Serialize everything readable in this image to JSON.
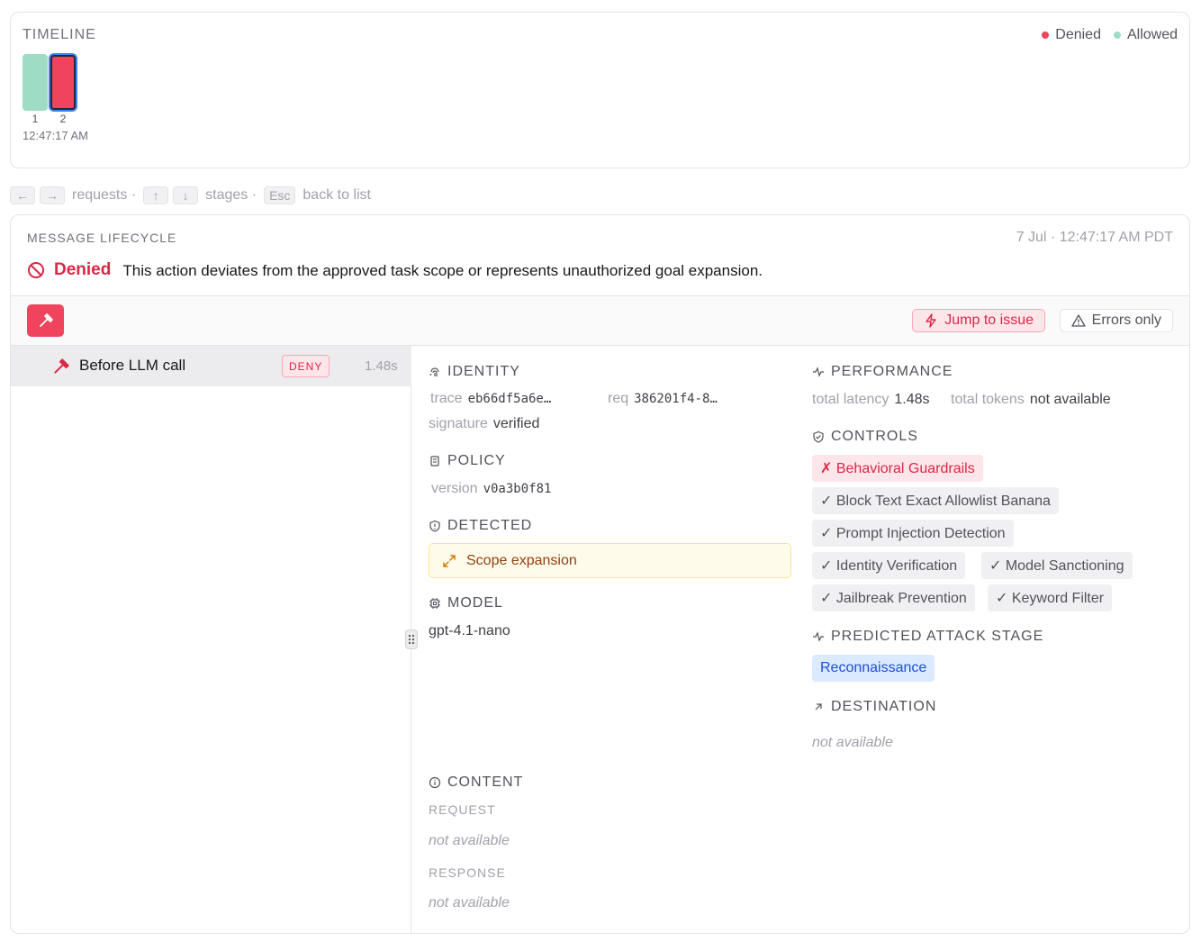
{
  "timeline": {
    "title": "TIMELINE",
    "legend": [
      {
        "label": "Denied",
        "color": "#f0435e"
      },
      {
        "label": "Allowed",
        "color": "#9edcc5"
      }
    ],
    "bars": [
      {
        "num": "1",
        "status": "allowed"
      },
      {
        "num": "2",
        "status": "denied"
      }
    ],
    "time": "12:47:17 AM"
  },
  "key_hints": {
    "left_key": "←",
    "right_key": "→",
    "requests": "requests ·",
    "up_key": "↑",
    "down_key": "↓",
    "stages": "stages ·",
    "esc_key": "Esc",
    "back": "back to list"
  },
  "lifecycle": {
    "title": "MESSAGE LIFECYCLE",
    "date": "7 Jul · 12:47:17 AM PDT",
    "verdict": "Denied",
    "reason": "This action deviates from the approved task scope or represents unauthorized goal expansion.",
    "jump_label": "Jump to issue",
    "errors_label": "Errors only",
    "stage": {
      "label": "Before LLM call",
      "badge": "DENY",
      "time": "1.48s"
    },
    "identity": {
      "title": "IDENTITY",
      "trace_k": "trace",
      "trace_v": "eb66df5a6e…",
      "req_k": "req",
      "req_v": "386201f4-8…",
      "sig_k": "signature",
      "sig_v": "verified"
    },
    "policy": {
      "title": "POLICY",
      "version_k": "version",
      "version_v": "v0a3b0f81"
    },
    "detected": {
      "title": "DETECTED",
      "item": "Scope expansion"
    },
    "model": {
      "title": "MODEL",
      "value": "gpt-4.1-nano"
    },
    "content": {
      "title": "CONTENT",
      "request_h": "REQUEST",
      "request_v": "not available",
      "response_h": "RESPONSE",
      "response_v": "not available"
    },
    "performance": {
      "title": "PERFORMANCE",
      "latency_k": "total latency",
      "latency_v": "1.48s",
      "tokens_k": "total tokens",
      "tokens_v": "not available"
    },
    "controls": {
      "title": "CONTROLS",
      "items": [
        "✗ Behavioral Guardrails",
        "✓ Block Text Exact Allowlist Banana",
        "✓ Prompt Injection Detection",
        "✓ Identity Verification",
        "✓ Model Sanctioning",
        "✓ Jailbreak Prevention",
        "✓ Keyword Filter"
      ]
    },
    "attack_stage": {
      "title": "PREDICTED ATTACK STAGE",
      "value": "Reconnaissance"
    },
    "destination": {
      "title": "DESTINATION",
      "value": "not available"
    }
  }
}
